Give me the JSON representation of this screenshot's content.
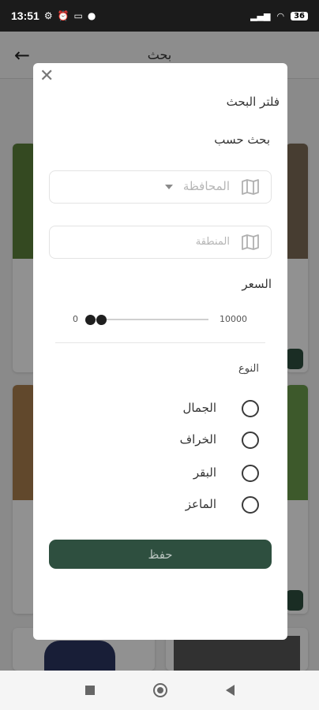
{
  "status_bar": {
    "time": "13:51",
    "battery": "36"
  },
  "app_bar": {
    "title": "بحث"
  },
  "filter": {
    "title": "فلتر البحث",
    "search_by": "بحث حسب",
    "governorate_placeholder": "المحافظة",
    "region_placeholder": "المنطقة",
    "price_label": "السعر",
    "price_min": "0",
    "price_max": "10000",
    "type_label": "النوع",
    "types": [
      {
        "label": "الجمال",
        "selected": false
      },
      {
        "label": "الخراف",
        "selected": false
      },
      {
        "label": "البقر",
        "selected": false
      },
      {
        "label": "الماعز",
        "selected": false
      }
    ],
    "save_label": "حفظ"
  },
  "colors": {
    "accent": "#2e4f3f",
    "overlay": "rgba(0,0,0,0.42)"
  }
}
